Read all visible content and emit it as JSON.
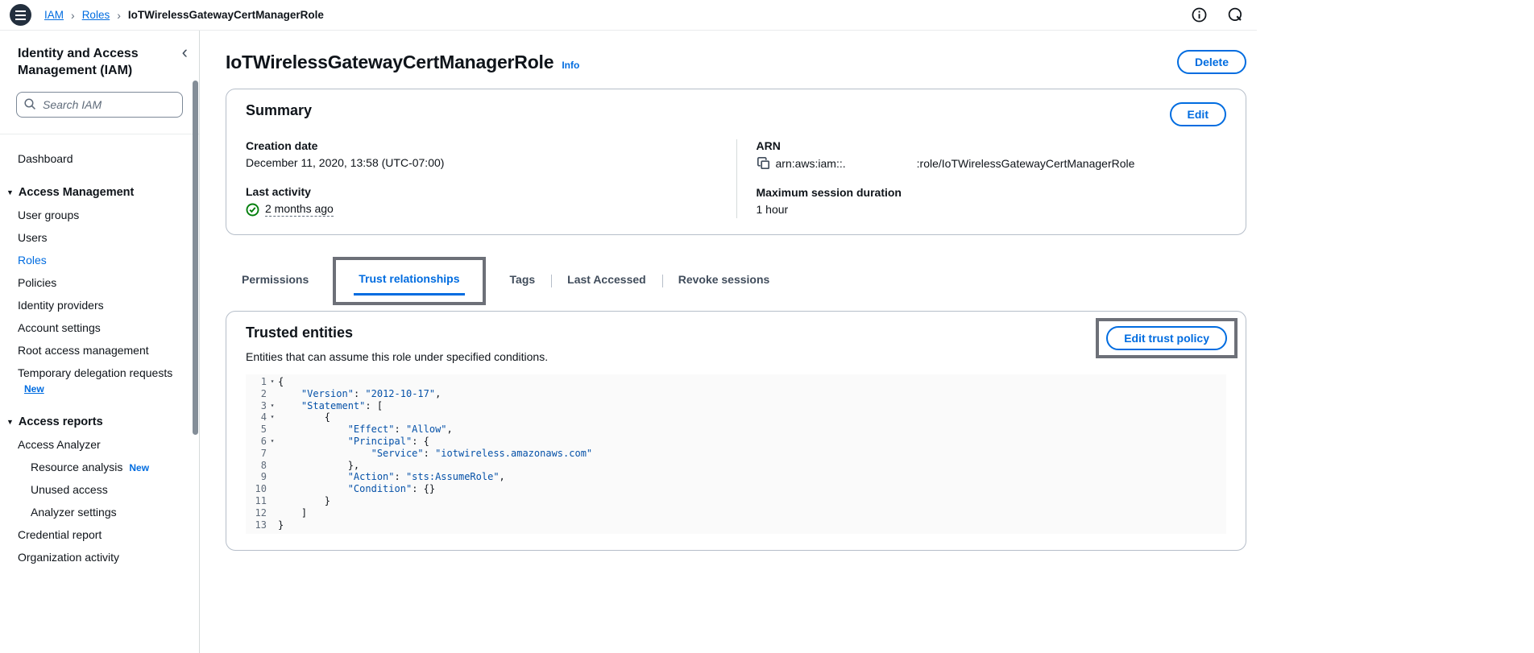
{
  "colors": {
    "accent_blue": "#006ce0",
    "annotation_gray": "#6d7078",
    "success_green": "#037f0c",
    "code_string_navy": "#0551a8",
    "topbar_menu_circle": "#232f3e"
  },
  "topbar": {
    "breadcrumb": [
      {
        "label": "IAM",
        "link": true
      },
      {
        "label": "Roles",
        "link": true
      },
      {
        "label": "IoTWirelessGatewayCertManagerRole",
        "link": false
      }
    ]
  },
  "sidebar": {
    "title": "Identity and Access Management (IAM)",
    "search_placeholder": "Search IAM",
    "items": [
      {
        "label": "Dashboard",
        "type": "link"
      },
      {
        "label": "Access Management",
        "type": "section"
      },
      {
        "label": "User groups",
        "type": "link"
      },
      {
        "label": "Users",
        "type": "link"
      },
      {
        "label": "Roles",
        "type": "link",
        "active": true
      },
      {
        "label": "Policies",
        "type": "link"
      },
      {
        "label": "Identity providers",
        "type": "link"
      },
      {
        "label": "Account settings",
        "type": "link"
      },
      {
        "label": "Root access management",
        "type": "link"
      },
      {
        "label": "Temporary delegation requests",
        "type": "link",
        "badge": "New",
        "badge_below": true
      },
      {
        "label": "Access reports",
        "type": "section"
      },
      {
        "label": "Access Analyzer",
        "type": "link"
      },
      {
        "label": "Resource analysis",
        "type": "sublink",
        "badge": "New"
      },
      {
        "label": "Unused access",
        "type": "sublink"
      },
      {
        "label": "Analyzer settings",
        "type": "sublink"
      },
      {
        "label": "Credential report",
        "type": "link"
      },
      {
        "label": "Organization activity",
        "type": "link"
      }
    ]
  },
  "page": {
    "title": "IoTWirelessGatewayCertManagerRole",
    "info_link": "Info",
    "delete_button": "Delete"
  },
  "summary": {
    "heading": "Summary",
    "edit_button": "Edit",
    "creation_date_label": "Creation date",
    "creation_date": "December 11, 2020, 13:58 (UTC-07:00)",
    "last_activity_label": "Last activity",
    "last_activity": "2 months ago",
    "arn_label": "ARN",
    "arn_prefix": "arn:aws:iam::.",
    "arn_suffix": ":role/IoTWirelessGatewayCertManagerRole",
    "max_session_label": "Maximum session duration",
    "max_session": "1 hour"
  },
  "tabs": [
    {
      "label": "Permissions"
    },
    {
      "label": "Trust relationships",
      "active": true,
      "annotated": true
    },
    {
      "label": "Tags"
    },
    {
      "label": "Last Accessed"
    },
    {
      "label": "Revoke sessions"
    }
  ],
  "trusted": {
    "heading": "Trusted entities",
    "edit_button": "Edit trust policy",
    "description": "Entities that can assume this role under specified conditions.",
    "policy_lines": [
      {
        "n": 1,
        "fold": true,
        "segments": [
          [
            "p",
            "{"
          ]
        ]
      },
      {
        "n": 2,
        "fold": false,
        "segments": [
          [
            "p",
            "    "
          ],
          [
            "s",
            "\"Version\""
          ],
          [
            "p",
            ": "
          ],
          [
            "s",
            "\"2012-10-17\""
          ],
          [
            "p",
            ","
          ]
        ]
      },
      {
        "n": 3,
        "fold": true,
        "segments": [
          [
            "p",
            "    "
          ],
          [
            "s",
            "\"Statement\""
          ],
          [
            "p",
            ": ["
          ]
        ]
      },
      {
        "n": 4,
        "fold": true,
        "segments": [
          [
            "p",
            "        {"
          ]
        ]
      },
      {
        "n": 5,
        "fold": false,
        "segments": [
          [
            "p",
            "            "
          ],
          [
            "s",
            "\"Effect\""
          ],
          [
            "p",
            ": "
          ],
          [
            "s",
            "\"Allow\""
          ],
          [
            "p",
            ","
          ]
        ]
      },
      {
        "n": 6,
        "fold": true,
        "segments": [
          [
            "p",
            "            "
          ],
          [
            "s",
            "\"Principal\""
          ],
          [
            "p",
            ": {"
          ]
        ]
      },
      {
        "n": 7,
        "fold": false,
        "segments": [
          [
            "p",
            "                "
          ],
          [
            "s",
            "\"Service\""
          ],
          [
            "p",
            ": "
          ],
          [
            "s",
            "\"iotwireless.amazonaws.com\""
          ]
        ]
      },
      {
        "n": 8,
        "fold": false,
        "segments": [
          [
            "p",
            "            },"
          ]
        ]
      },
      {
        "n": 9,
        "fold": false,
        "segments": [
          [
            "p",
            "            "
          ],
          [
            "s",
            "\"Action\""
          ],
          [
            "p",
            ": "
          ],
          [
            "s",
            "\"sts:AssumeRole\""
          ],
          [
            "p",
            ","
          ]
        ]
      },
      {
        "n": 10,
        "fold": false,
        "segments": [
          [
            "p",
            "            "
          ],
          [
            "s",
            "\"Condition\""
          ],
          [
            "p",
            ": {}"
          ]
        ]
      },
      {
        "n": 11,
        "fold": false,
        "segments": [
          [
            "p",
            "        }"
          ]
        ]
      },
      {
        "n": 12,
        "fold": false,
        "segments": [
          [
            "p",
            "    ]"
          ]
        ]
      },
      {
        "n": 13,
        "fold": false,
        "segments": [
          [
            "p",
            "}"
          ]
        ]
      }
    ]
  }
}
